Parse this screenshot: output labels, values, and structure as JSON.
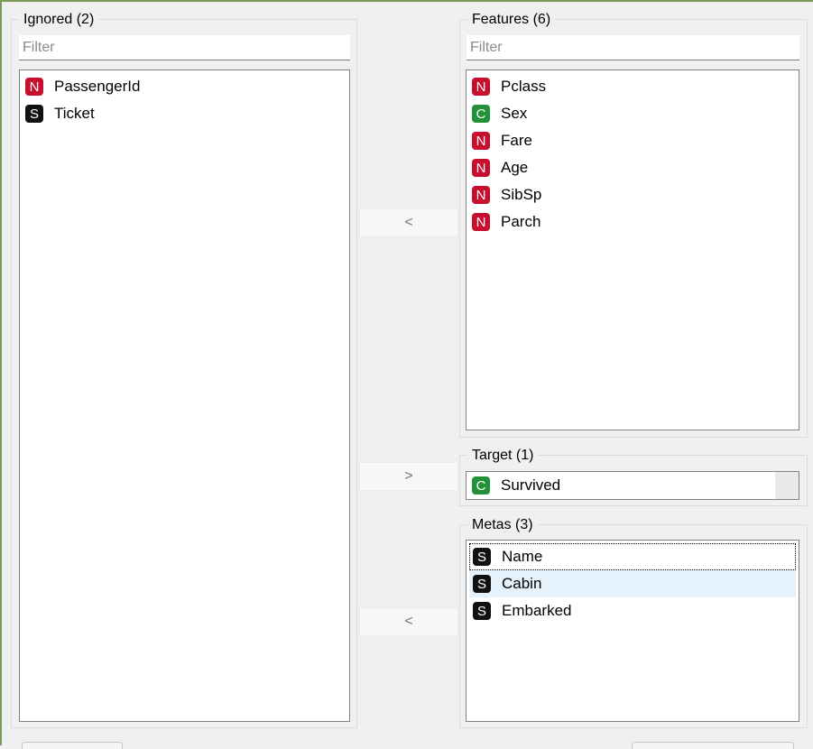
{
  "ignored": {
    "title": "Ignored (2)",
    "filter_placeholder": "Filter",
    "items": [
      {
        "type": "N",
        "label": "PassengerId",
        "color": "#c8102e"
      },
      {
        "type": "S",
        "label": "Ticket",
        "color": "#111111"
      }
    ]
  },
  "features": {
    "title": "Features (6)",
    "filter_placeholder": "Filter",
    "items": [
      {
        "type": "N",
        "label": "Pclass"
      },
      {
        "type": "C",
        "label": "Sex"
      },
      {
        "type": "N",
        "label": "Fare"
      },
      {
        "type": "N",
        "label": "Age"
      },
      {
        "type": "N",
        "label": "SibSp"
      },
      {
        "type": "N",
        "label": "Parch"
      }
    ]
  },
  "target": {
    "title": "Target (1)",
    "items": [
      {
        "type": "C",
        "label": "Survived"
      }
    ]
  },
  "metas": {
    "title": "Metas (3)",
    "items": [
      {
        "type": "S",
        "label": "Name"
      },
      {
        "type": "S",
        "label": "Cabin"
      },
      {
        "type": "S",
        "label": "Embarked"
      }
    ]
  },
  "buttons": {
    "move_to_ignored_from_features": "<",
    "move_to_target": ">",
    "move_to_ignored_from_metas": "<"
  },
  "colors": {
    "numeric": "#c8102e",
    "categorical": "#22913a",
    "string": "#111111",
    "selection": "#e5f1fb"
  }
}
